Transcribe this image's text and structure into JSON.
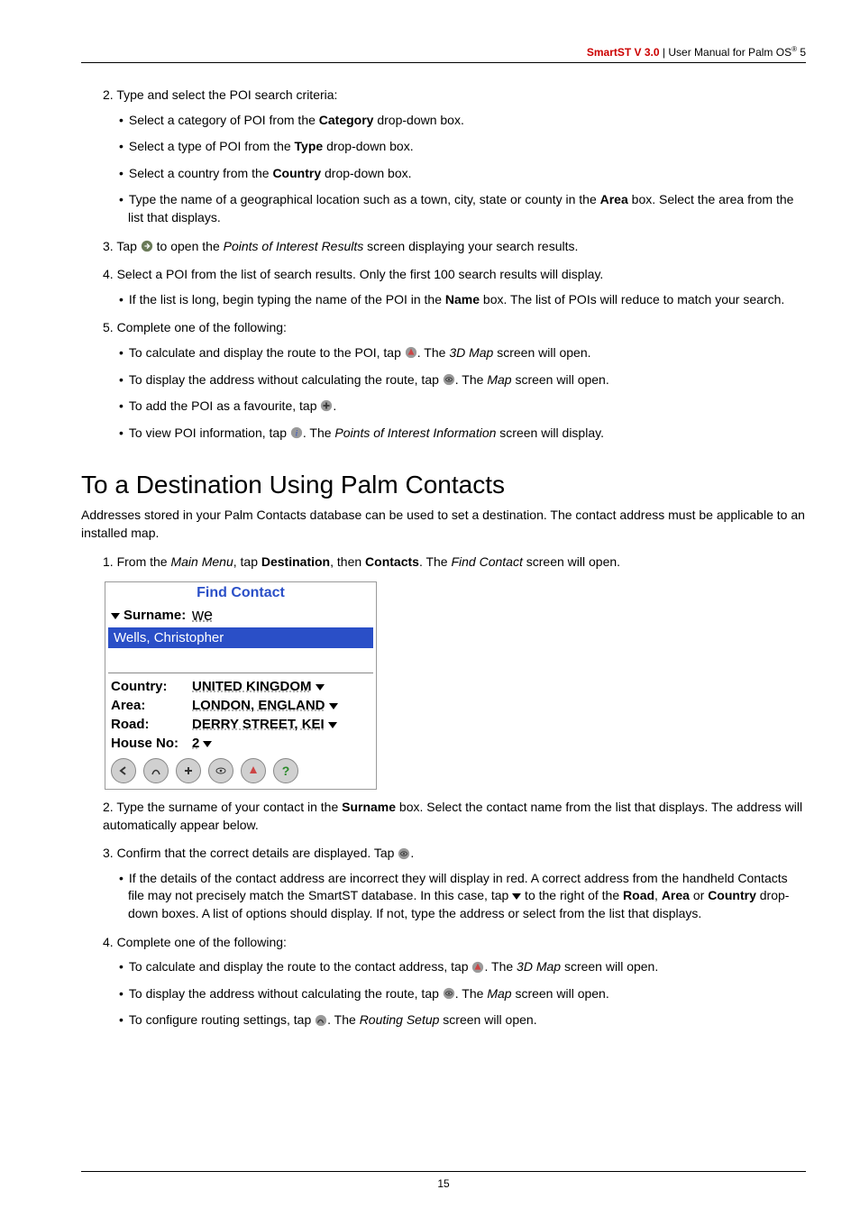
{
  "header": {
    "product": "SmartST V 3.0",
    "divider": " | ",
    "doc": "User Manual for Palm OS",
    "reg": "®",
    "ver": " 5"
  },
  "sec1": {
    "step2": "2. Type and select the POI search criteria:",
    "s2a_pre": "Select a category of POI from the ",
    "s2a_bold": "Category",
    "s2a_post": " drop-down box.",
    "s2b_pre": "Select a type of POI from the ",
    "s2b_bold": "Type",
    "s2b_post": " drop-down box.",
    "s2c_pre": "Select a country from the ",
    "s2c_bold": "Country",
    "s2c_post": " drop-down box.",
    "s2d_pre": "Type the name of a geographical location such as a town, city, state or county in the ",
    "s2d_bold": "Area",
    "s2d_post": " box. Select the area from the list that displays.",
    "step3_pre": "3. Tap ",
    "step3_mid": " to open the ",
    "step3_it": "Points of Interest Results",
    "step3_post": " screen displaying your search results.",
    "step4": "4. Select a POI from the list of search results. Only the first 100 search results will display.",
    "s4a_pre": "If the list is long, begin typing the name of the POI in the ",
    "s4a_bold": "Name",
    "s4a_post": " box. The list of POIs will reduce to match your search.",
    "step5": "5. Complete one of the following:",
    "s5a_pre": "To calculate and display the route to the POI, tap ",
    "s5a_mid": ". The ",
    "s5a_it": "3D Map",
    "s5a_post": " screen will open.",
    "s5b_pre": "To display the address without calculating the route, tap ",
    "s5b_mid": ". The ",
    "s5b_it": "Map",
    "s5b_post": " screen will open.",
    "s5c_pre": "To add the POI as a favourite, tap ",
    "s5c_post": ".",
    "s5d_pre": "To view POI information, tap ",
    "s5d_mid": ". The ",
    "s5d_it": "Points of Interest Information",
    "s5d_post": " screen will display."
  },
  "sec2": {
    "heading": "To a Destination Using Palm Contacts",
    "intro": "Addresses stored in your Palm Contacts database can be used to set a destination. The contact address must be applicable to an installed map.",
    "step1_pre": "1. From the ",
    "step1_it1": "Main Menu",
    "step1_mid1": ", tap ",
    "step1_b1": "Destination",
    "step1_mid2": ", then ",
    "step1_b2": "Contacts",
    "step1_mid3": ". The ",
    "step1_it2": "Find Contact",
    "step1_post": " screen will open.",
    "step2_pre": "2. Type the surname of your contact in the ",
    "step2_b": "Surname",
    "step2_post": " box. Select the contact name from the list that displays. The address will automatically appear below.",
    "step3_pre": "3. Confirm that the correct details are displayed. Tap ",
    "step3_post": ".",
    "s3a_pre": "If the details of the contact address are incorrect they will display in red. A correct address from the handheld Contacts file may not precisely match the SmartST database. In this case, tap ",
    "s3a_mid": " to the right of the ",
    "s3a_b1": "Road",
    "s3a_c1": ", ",
    "s3a_b2": "Area",
    "s3a_c2": " or ",
    "s3a_b3": "Country",
    "s3a_post": " drop-down boxes. A list of options should display. If not, type the address or select from the list that displays.",
    "step4": "4. Complete one of the following:",
    "s4a_pre": "To calculate and display the route to the contact address, tap ",
    "s4a_mid": ". The ",
    "s4a_it": "3D Map",
    "s4a_post": " screen will open.",
    "s4b_pre": "To display the address without calculating the route, tap ",
    "s4b_mid": ". The ",
    "s4b_it": "Map",
    "s4b_post": " screen will open.",
    "s4c_pre": "To configure routing settings, tap ",
    "s4c_mid": ". The ",
    "s4c_it": "Routing Setup",
    "s4c_post": " screen will open."
  },
  "mock": {
    "title": "Find Contact",
    "surname_label": "Surname:",
    "surname_val": "we",
    "list_item": "Wells, Christopher",
    "country_label": "Country:",
    "country_val": "UNITED KINGDOM",
    "area_label": "Area:",
    "area_val": "LONDON, ENGLAND",
    "road_label": "Road:",
    "road_val": "DERRY STREET, KEI",
    "house_label": "House No:",
    "house_val": "2"
  },
  "footer": {
    "page": "15"
  }
}
